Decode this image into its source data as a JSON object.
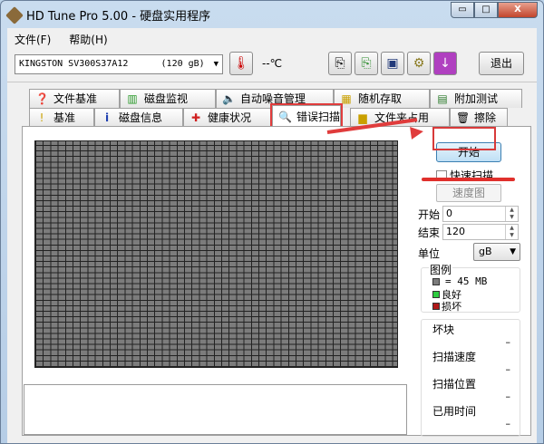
{
  "window": {
    "title": "HD Tune Pro 5.00 - 硬盘实用程序",
    "minimize": "▭",
    "maximize": "□",
    "close": "X"
  },
  "menu": [
    "文件(F)",
    "帮助(H)"
  ],
  "toolbar": {
    "drive": "KINGSTON SV300S37A12      (120 gB)",
    "temperature": "--℃",
    "exit": "退出"
  },
  "tabs_top": [
    "文件基准",
    "磁盘监视",
    "自动噪音管理",
    "随机存取",
    "附加测试"
  ],
  "tabs_bottom": [
    "基准",
    "磁盘信息",
    "健康状况",
    "错误扫描",
    "文件夹占用",
    "擦除"
  ],
  "active_tab": "错误扫描",
  "scan": {
    "start_button": "开始",
    "quick_scan": "快速扫描",
    "quick_scan_checked": false,
    "speed_map": "速度图",
    "start_label": "开始",
    "start_value": "0",
    "end_label": "结束",
    "end_value": "120",
    "unit_label": "单位",
    "unit_value": "gB"
  },
  "legend": {
    "title": "图例",
    "block": "= 45 MB",
    "good": "良好",
    "bad": "损坏",
    "colors": {
      "block": "#7c7c7c",
      "good": "#2ecc40",
      "bad": "#b01818"
    }
  },
  "stats": [
    {
      "label": "坏块",
      "value": "–"
    },
    {
      "label": "扫描速度",
      "value": "–"
    },
    {
      "label": "扫描位置",
      "value": "–"
    },
    {
      "label": "已用时间",
      "value": "–"
    }
  ]
}
